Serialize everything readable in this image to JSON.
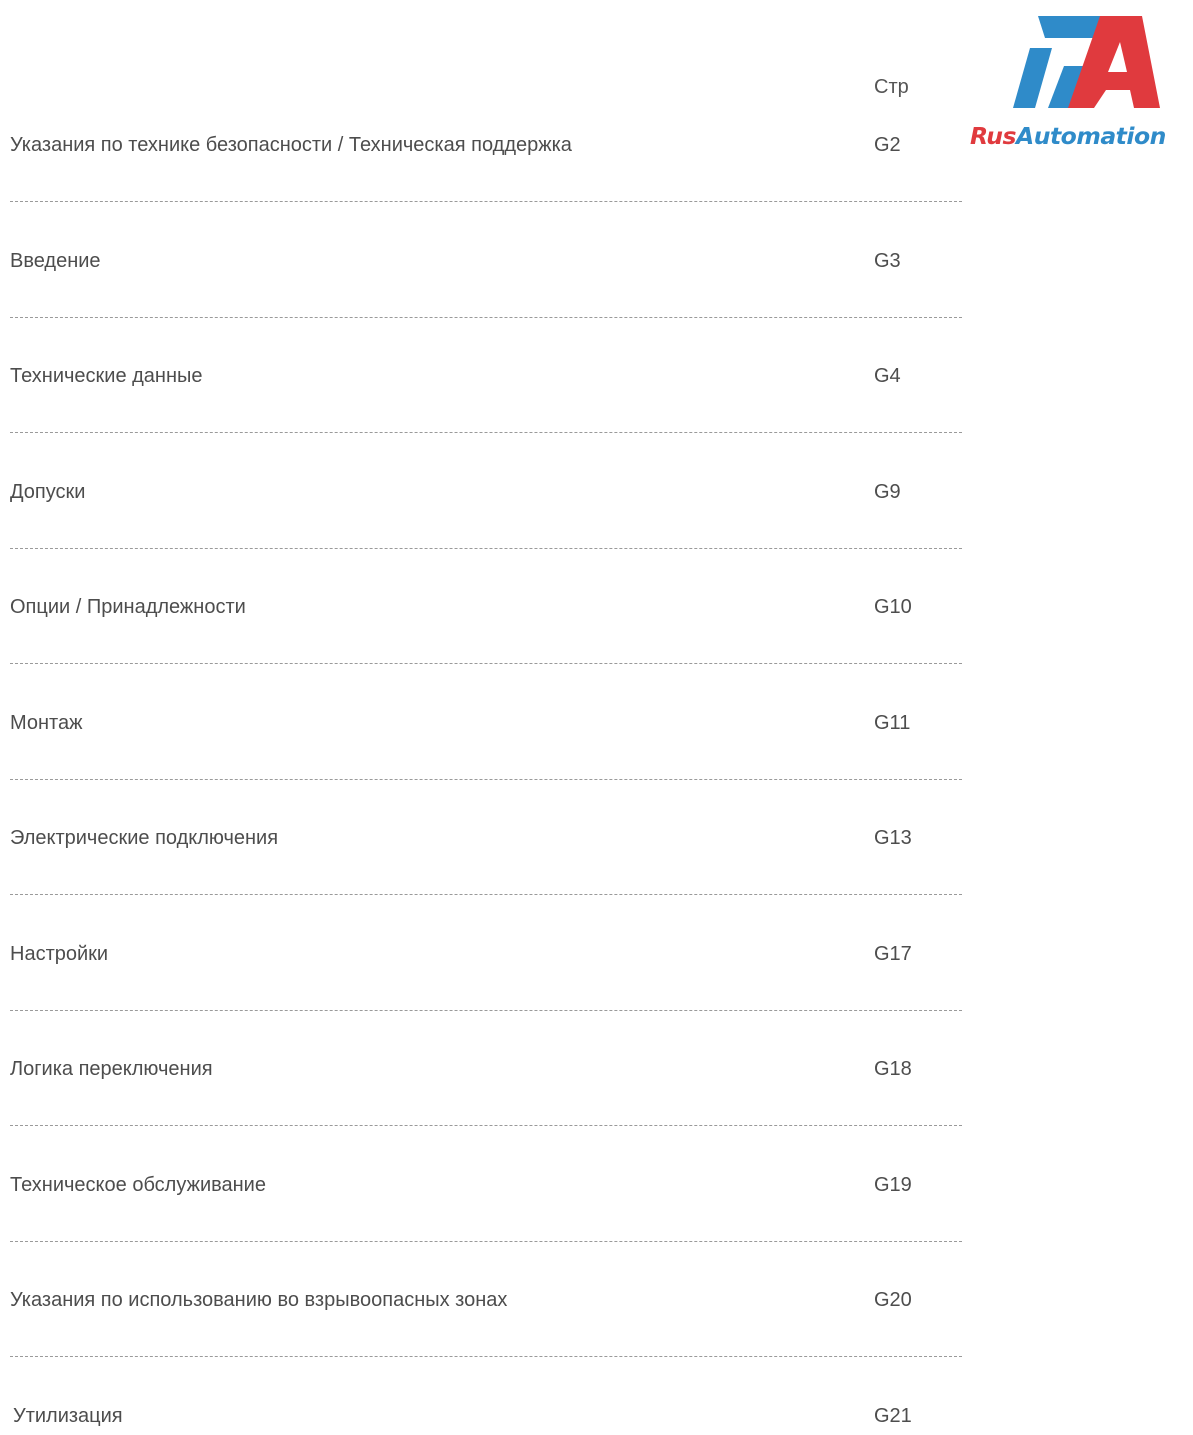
{
  "logo": {
    "brand_part1": "Rus",
    "brand_part2": "Automation",
    "colors": {
      "blue": "#2f8bc9",
      "red": "#e03a3e"
    }
  },
  "header": {
    "page_column_label": "Стр"
  },
  "toc": [
    {
      "title": "Указания по технике безопасности / Техническая поддержка",
      "page": "G2"
    },
    {
      "title": "Введение",
      "page": "G3"
    },
    {
      "title": "Технические данные",
      "page": "G4"
    },
    {
      "title": "Допуски",
      "page": "G9"
    },
    {
      "title": "Опции / Принадлежности",
      "page": "G10"
    },
    {
      "title": "Монтаж",
      "page": "G11"
    },
    {
      "title": "Электрические подключения",
      "page": "G13"
    },
    {
      "title": "Настройки",
      "page": "G17"
    },
    {
      "title": "Логика переключения",
      "page": "G18"
    },
    {
      "title": "Техническое обслуживание",
      "page": "G19"
    },
    {
      "title": "Указания по использованию во взрывоопасных зонах",
      "page": "G20"
    },
    {
      "title": "Утилизация",
      "page": "G21"
    }
  ]
}
